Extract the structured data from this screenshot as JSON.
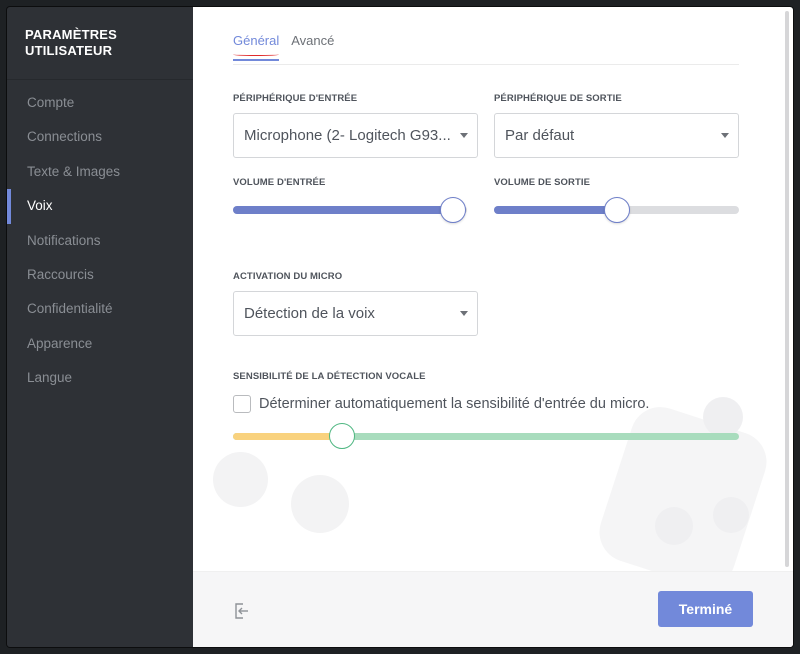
{
  "sidebar": {
    "title_line1": "PARAMÈTRES",
    "title_line2": "UTILISATEUR",
    "items": [
      {
        "label": "Compte"
      },
      {
        "label": "Connections"
      },
      {
        "label": "Texte & Images"
      },
      {
        "label": "Voix",
        "active": true
      },
      {
        "label": "Notifications"
      },
      {
        "label": "Raccourcis"
      },
      {
        "label": "Confidentialité"
      },
      {
        "label": "Apparence"
      },
      {
        "label": "Langue"
      }
    ]
  },
  "tabs": [
    {
      "label": "Général",
      "active": true
    },
    {
      "label": "Avancé"
    }
  ],
  "input_device": {
    "label": "PÉRIPHÉRIQUE D'ENTRÉE",
    "value": "Microphone (2- Logitech G93..."
  },
  "output_device": {
    "label": "PÉRIPHÉRIQUE DE SORTIE",
    "value": "Par défaut"
  },
  "input_volume": {
    "label": "VOLUME D'ENTRÉE",
    "level": 0.94
  },
  "output_volume": {
    "label": "VOLUME DE SORTIE",
    "level": 0.5
  },
  "mic_activation": {
    "label": "ACTIVATION DU MICRO",
    "value": "Détection de la voix"
  },
  "sensitivity": {
    "label": "SENSIBILITÉ DE LA DÉTECTION VOCALE",
    "auto_label": "Déterminer automatiquement la sensibilité d'entrée du micro.",
    "auto_checked": false,
    "level": 0.215
  },
  "footer": {
    "done_label": "Terminé"
  },
  "colors": {
    "accent": "#7289da",
    "sidebar_bg": "#2e3136",
    "sensitivity_low": "#f9d27e",
    "sensitivity_high": "#a8dcbd"
  }
}
